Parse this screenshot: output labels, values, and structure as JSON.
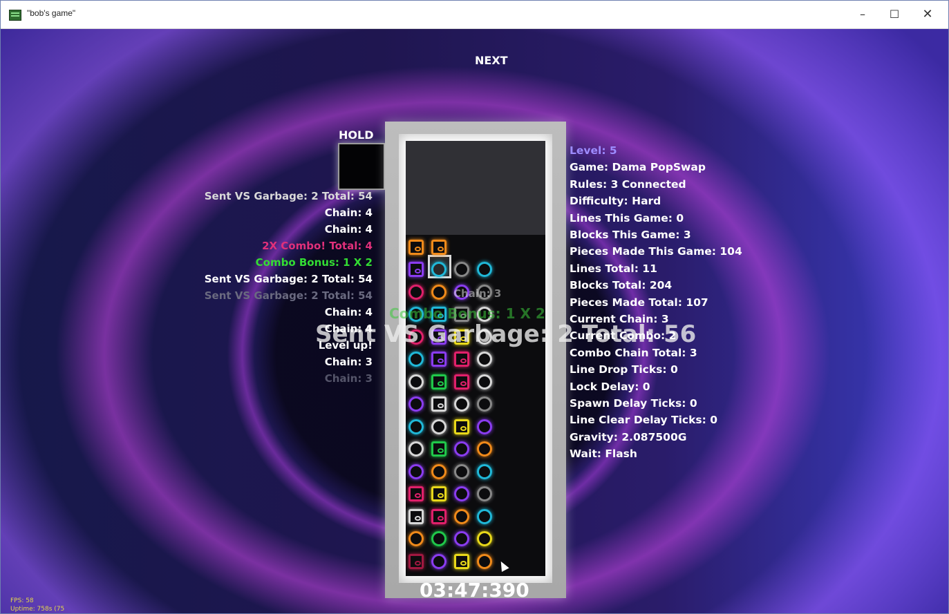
{
  "window": {
    "title": "\"bob's game\"",
    "icon": "app-icon",
    "minimize_glyph": "–",
    "maximize_glyph": "☐",
    "close_glyph": "✕"
  },
  "game": {
    "next_label": "NEXT",
    "hold_label": "HOLD",
    "timer": "03:47:390",
    "overlay_big": "Sent VS Garbage: 2 Total: 56",
    "overlay_combo": "Combo Bonus: 1 X 2",
    "overlay_chain": "Chain: 3"
  },
  "left_log": [
    {
      "text": "Sent VS Garbage: 2 Total: 54",
      "color": "#d9d9d9"
    },
    {
      "text": "Chain: 4",
      "color": "#ffffff"
    },
    {
      "text": "Chain: 4",
      "color": "#ffffff"
    },
    {
      "text": "2X Combo! Total: 4",
      "color": "#e0307a"
    },
    {
      "text": "Combo Bonus: 1 X 2",
      "color": "#33dd33"
    },
    {
      "text": "Sent VS Garbage: 2 Total: 54",
      "color": "#ffffff"
    },
    {
      "text": "Sent VS Garbage: 2 Total: 54",
      "color": "#6a6a80"
    },
    {
      "text": "Chain: 4",
      "color": "#ffffff"
    },
    {
      "text": "Chain: 4",
      "color": "#ffffff"
    },
    {
      "text": "Level up!",
      "color": "#ffffff"
    },
    {
      "text": "Chain: 3",
      "color": "#ffffff"
    },
    {
      "text": "Chain: 3",
      "color": "#55556a"
    }
  ],
  "info": [
    {
      "text": "Level: 5",
      "color": "#9d8cff"
    },
    {
      "text": "Game: Dama PopSwap",
      "color": "#ffffff"
    },
    {
      "text": "Rules: 3 Connected",
      "color": "#ffffff"
    },
    {
      "text": "Difficulty: Hard",
      "color": "#ffffff"
    },
    {
      "text": "Lines This Game: 0",
      "color": "#ffffff"
    },
    {
      "text": "Blocks This Game: 3",
      "color": "#ffffff"
    },
    {
      "text": "Pieces Made This Game: 104",
      "color": "#ffffff"
    },
    {
      "text": "Lines Total: 11",
      "color": "#ffffff"
    },
    {
      "text": "Blocks Total: 204",
      "color": "#ffffff"
    },
    {
      "text": "Pieces Made Total: 107",
      "color": "#ffffff"
    },
    {
      "text": "Current Chain: 3",
      "color": "#ffffff"
    },
    {
      "text": "Current Combo: 2",
      "color": "#ffffff"
    },
    {
      "text": "Combo Chain Total: 3",
      "color": "#ffffff"
    },
    {
      "text": "Line Drop Ticks: 0",
      "color": "#ffffff"
    },
    {
      "text": "Lock Delay: 0",
      "color": "#ffffff"
    },
    {
      "text": "Spawn Delay Ticks: 0",
      "color": "#ffffff"
    },
    {
      "text": "Line Clear Delay Ticks: 0",
      "color": "#ffffff"
    },
    {
      "text": "Gravity: 2.087500G",
      "color": "#ffffff"
    },
    {
      "text": "Wait: Flash",
      "color": "#ffffff"
    }
  ],
  "stats": {
    "fps": "FPS: 58",
    "uptime": "Uptime: 758s (75"
  },
  "palette": {
    "o": "#f08a1a",
    "p": "#8a3cf0",
    "r": "#e0206a",
    "y": "#e8d81a",
    "c": "#20b8d8",
    "g": "#20c84a",
    "w": "#d8d8d8",
    "b": "#5a3cd0",
    "d": "#a01840"
  },
  "board": [
    "...........",
    "..os..os...",
    "ps.cosrcyc.",
    "rc.ocpcsww.",
    "cc.cssswpp.",
    "rc.psyswyc.",
    "cc.psrswgw.",
    "wc.gsrswrg.",
    "pc.wswosgb.",
    "cc.wcyspwg.",
    "wc.gspcoyg.",
    "pc.owspcgw.",
    "rs.yspcsoc.",
    "ws.rsorcgy.",
    "oc.gcpcypw.",
    "ds.pcysodd."
  ]
}
